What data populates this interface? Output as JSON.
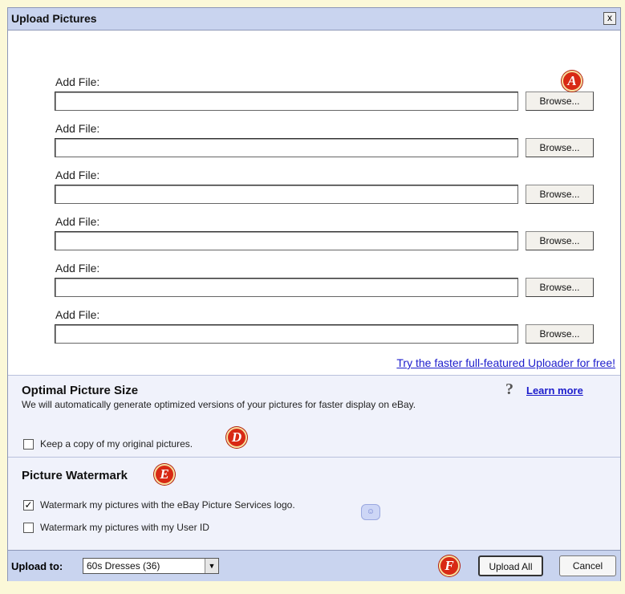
{
  "window": {
    "title": "Upload Pictures",
    "close_glyph": "x"
  },
  "files": [
    {
      "label": "Add File:",
      "value": "",
      "browse_label": "Browse..."
    },
    {
      "label": "Add File:",
      "value": "",
      "browse_label": "Browse..."
    },
    {
      "label": "Add File:",
      "value": "",
      "browse_label": "Browse..."
    },
    {
      "label": "Add File:",
      "value": "",
      "browse_label": "Browse..."
    },
    {
      "label": "Add File:",
      "value": "",
      "browse_label": "Browse..."
    },
    {
      "label": "Add File:",
      "value": "",
      "browse_label": "Browse..."
    }
  ],
  "uploader_link": "Try the faster full-featured Uploader for free!",
  "optimal_size": {
    "title": "Optimal Picture Size",
    "description": "We will automatically generate optimized versions of your pictures for faster display on eBay.",
    "help_icon": "?",
    "learn_more": "Learn more",
    "keep_copy_label": "Keep a copy of my original pictures.",
    "keep_copy_checked": false
  },
  "watermark": {
    "title": "Picture Watermark",
    "option_logo_label": "Watermark my pictures with the eBay Picture Services logo.",
    "option_logo_checked": true,
    "option_userid_label": "Watermark my pictures with my User ID",
    "option_userid_checked": false
  },
  "footer": {
    "upload_to_label": "Upload to:",
    "album_selected": "60s Dresses (36)",
    "upload_all": "Upload All",
    "cancel": "Cancel"
  },
  "markers": {
    "a": "A",
    "d": "D",
    "e": "E",
    "f": "F"
  },
  "colors": {
    "marker": "#d82914",
    "titlebar": "#c9d4ef",
    "link": "#1d1dcc"
  }
}
